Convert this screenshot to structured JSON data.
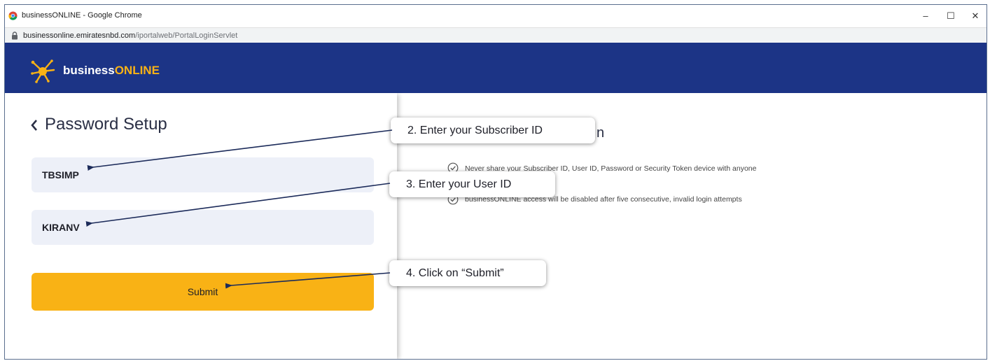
{
  "window": {
    "title": "businessONLINE - Google Chrome",
    "url_host": "businessonline.emiratesnbd.com",
    "url_path": "/iportalweb/PortalLoginServlet",
    "controls": {
      "minimize": "–",
      "maximize": "☐",
      "close": "✕"
    }
  },
  "header": {
    "logo_prefix": "business",
    "logo_accent": "ONLINE"
  },
  "form": {
    "title": "Password Setup",
    "subscriber_id": "TBSIMP",
    "user_id": "KIRANV",
    "submit_label": "Submit"
  },
  "info": {
    "heading_fragment": "n",
    "tips": [
      "Never share your Subscriber ID, User ID, Password or Security Token device with anyone",
      "businessONLINE access will be disabled after five consecutive, invalid login attempts"
    ]
  },
  "callouts": {
    "step2": "2.  Enter your Subscriber ID",
    "step3": "3.  Enter your User ID",
    "step4": "4.  Click on “Submit”"
  },
  "colors": {
    "header": "#1c3486",
    "accent": "#f9b215",
    "field_bg": "#edf0f8",
    "arrow": "#1c2b5a"
  }
}
